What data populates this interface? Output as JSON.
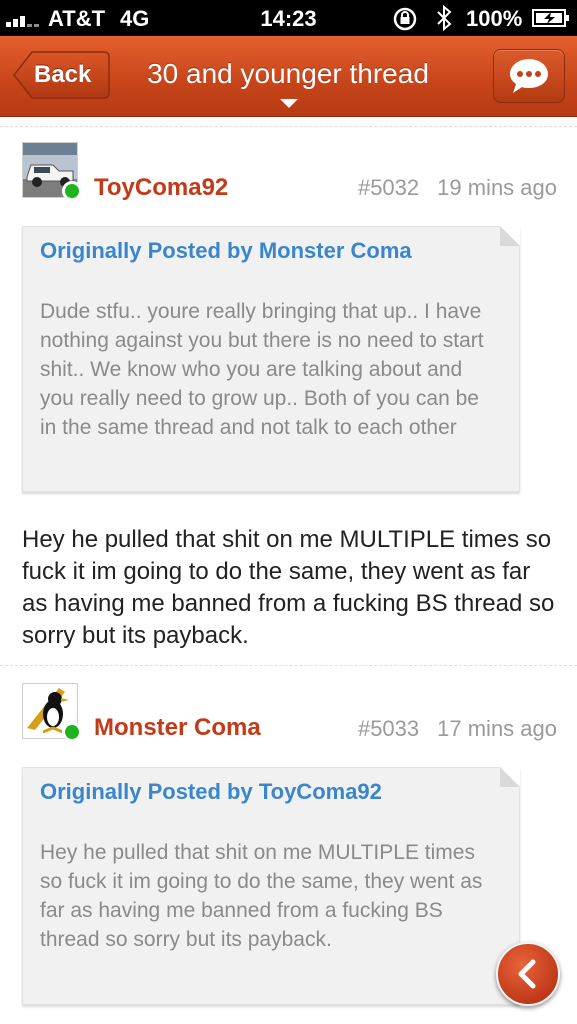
{
  "status_bar": {
    "carrier": "AT&T",
    "network": "4G",
    "time": "14:23",
    "battery": "100%"
  },
  "nav": {
    "back_label": "Back",
    "title": "30 and younger thread",
    "chat_icon": "chat-bubble-icon"
  },
  "posts": [
    {
      "username": "ToyComa92",
      "number": "#5032",
      "time": "19 mins ago",
      "online": true,
      "quote": {
        "author": "Originally Posted by Monster Coma",
        "text": "Dude stfu.. youre really bringing that up.. I have nothing against you but there is no need to start shit.. We know who you are talking about and you really need to grow up.. Both of you can be in the same thread and not talk to each other"
      },
      "body": "Hey he pulled that shit on me MULTIPLE times so fuck it im going to do the same, they went as far as having me banned from a fucking BS thread so sorry but its payback."
    },
    {
      "username": "Monster Coma",
      "number": "#5033",
      "time": "17 mins ago",
      "online": true,
      "quote": {
        "author": "Originally Posted by ToyComa92",
        "text": "Hey he pulled that shit on me MULTIPLE times so fuck it im going to do the same, they went as far as having me banned from a fucking BS thread so sorry but its payback."
      }
    }
  ],
  "floating_button_icon": "chevron-left-icon",
  "colors": {
    "nav_orange": "#c7441a",
    "username_red": "#c23a18",
    "quote_author_blue": "#3a86cc",
    "online_green": "#1db41d"
  }
}
